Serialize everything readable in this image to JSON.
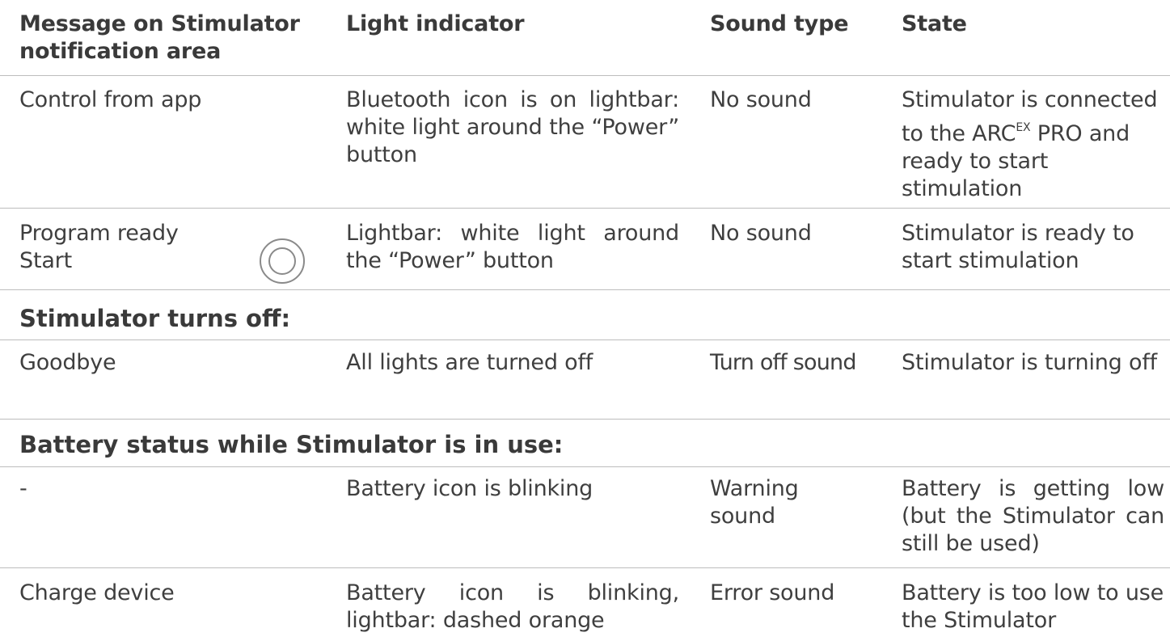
{
  "header": {
    "col1_line1": "Message on Stimulator",
    "col1_line2": "notification area",
    "col2": "Light indicator",
    "col3": "Sound type",
    "col4": "State"
  },
  "rows": [
    {
      "message": "Control from app",
      "light": "Bluetooth icon is on lightbar: white light around the “Power” button",
      "sound": "No sound",
      "state_pre": "Stimulator is connected to the ARC",
      "state_sup": "EX",
      "state_post": " PRO and ready to start stimulation"
    },
    {
      "message_line1": "Program ready",
      "message_line2": "Start",
      "icon": "power-ring-icon",
      "light": "Lightbar: white light around the “Power” button",
      "sound": "No sound",
      "state": "Stimulator is ready to start stimulation"
    }
  ],
  "section_off": {
    "title": "Stimulator turns off:",
    "row": {
      "message": "Goodbye",
      "light": "All lights are turned off",
      "sound": "Turn off sound",
      "state": "Stimulator is turning off"
    }
  },
  "section_battery": {
    "title": "Battery status while Stimulator is in use:",
    "rows": [
      {
        "message": "-",
        "light": "Battery icon is blinking",
        "sound": "Warning sound",
        "state": "Battery is getting low (but the Stimulator can still be used)"
      },
      {
        "message": "Charge device",
        "light": "Battery icon is blinking, lightbar: dashed orange",
        "sound": "Error sound",
        "state": "Battery is too low to use the Stimulator"
      }
    ]
  },
  "colors": {
    "text": "#3f3f3f",
    "rule": "#bdbdbd",
    "icon": "#8a8a8a"
  }
}
